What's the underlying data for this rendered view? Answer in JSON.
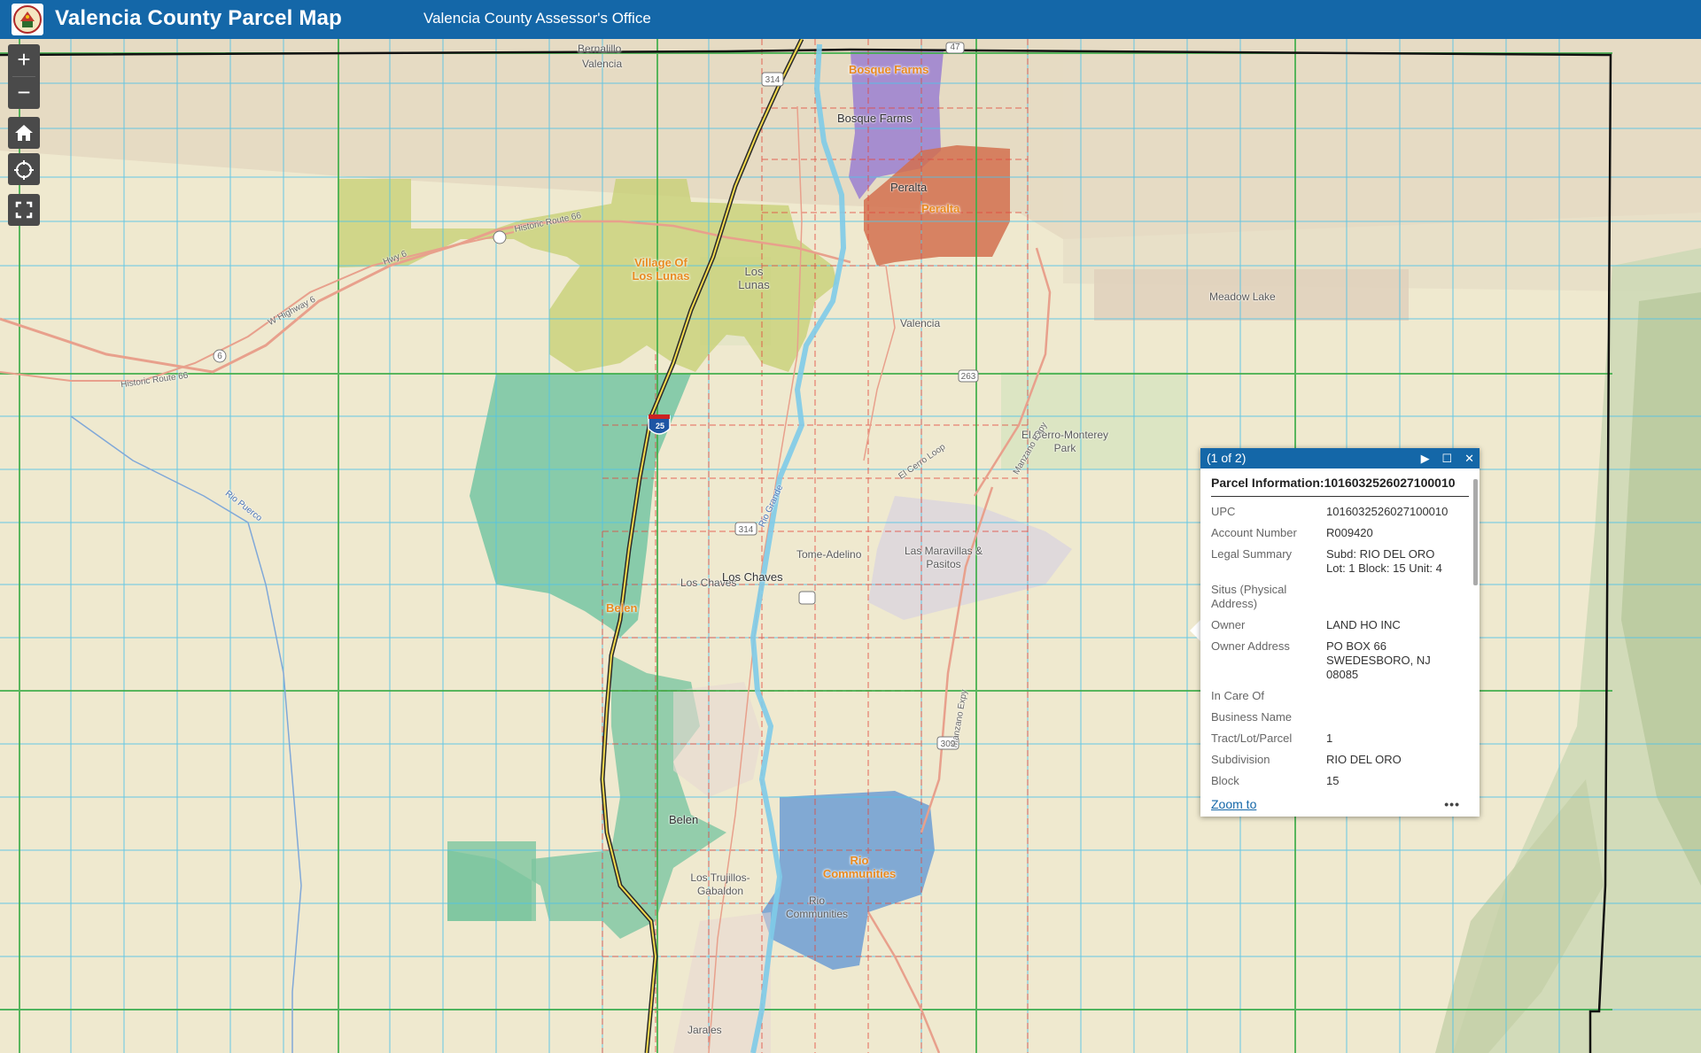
{
  "header": {
    "title": "Valencia County Parcel Map",
    "subtitle": "Valencia County Assessor's Office"
  },
  "map_controls": {
    "zoom_in": "+",
    "zoom_out": "−"
  },
  "map_labels": {
    "bernalillo": "Bernalillo",
    "valencia_top": "Valencia",
    "bosque_farms_muni": "Bosque Farms",
    "bosque_farms": "Bosque Farms",
    "peralta": "Peralta",
    "peralta_muni": "Peralta",
    "los_lunas_village": "Village Of Los Lunas",
    "los_lunas": "Los Lunas",
    "valencia": "Valencia",
    "meadow_lake": "Meadow Lake",
    "el_cerro": "El Cerro-Monterey Park",
    "tome": "Tome-Adelino",
    "las_maravillas": "Las Maravillas & Pasitos",
    "los_chaves_1": "Los Chaves",
    "los_chaves_2": "Los Chaves",
    "belen_muni": "Belen",
    "belen": "Belen",
    "los_trujillos": "Los Trujillos-Gabaldon",
    "rio_communities_muni": "Rio Communities",
    "rio_communities": "Rio Communities",
    "jarales": "Jarales",
    "historic_route_66_a": "Historic Route 66",
    "historic_route_66_b": "Historic Route 66",
    "w_highway_6": "W Highway 6",
    "hwy_6": "Hwy 6",
    "rio_puerco": "Rio Puerco",
    "rio_grande": "Rio Grande",
    "el_cerro_loop": "El Cerro Loop",
    "manzano_expy_a": "Manzano Expy",
    "manzano_expy_b": "Manzano Expy",
    "shield_25": "25",
    "shield_314a": "314",
    "shield_314b": "314",
    "shield_47": "47",
    "shield_309": "309",
    "shield_263": "263",
    "shield_6": "6"
  },
  "popup": {
    "counter": "(1 of 2)",
    "title": "Parcel Information:1016032526027100010",
    "fields": [
      {
        "label": "UPC",
        "value": "1016032526027100010"
      },
      {
        "label": "Account Number",
        "value": "R009420"
      },
      {
        "label": "Legal Summary",
        "value": "Subd: RIO DEL ORO\nLot: 1 Block: 15 Unit: 4"
      },
      {
        "label": "Situs (Physical Address)",
        "value": ""
      },
      {
        "label": "Owner",
        "value": "LAND HO INC"
      },
      {
        "label": "Owner Address",
        "value": "PO BOX 66\nSWEDESBORO, NJ\n08085"
      },
      {
        "label": "In Care Of",
        "value": ""
      },
      {
        "label": "Business Name",
        "value": ""
      },
      {
        "label": "Tract/Lot/Parcel",
        "value": "1"
      },
      {
        "label": "Subdivision",
        "value": "RIO DEL ORO"
      },
      {
        "label": "Block",
        "value": "15"
      }
    ],
    "zoom_to": "Zoom to",
    "more": "•••"
  }
}
